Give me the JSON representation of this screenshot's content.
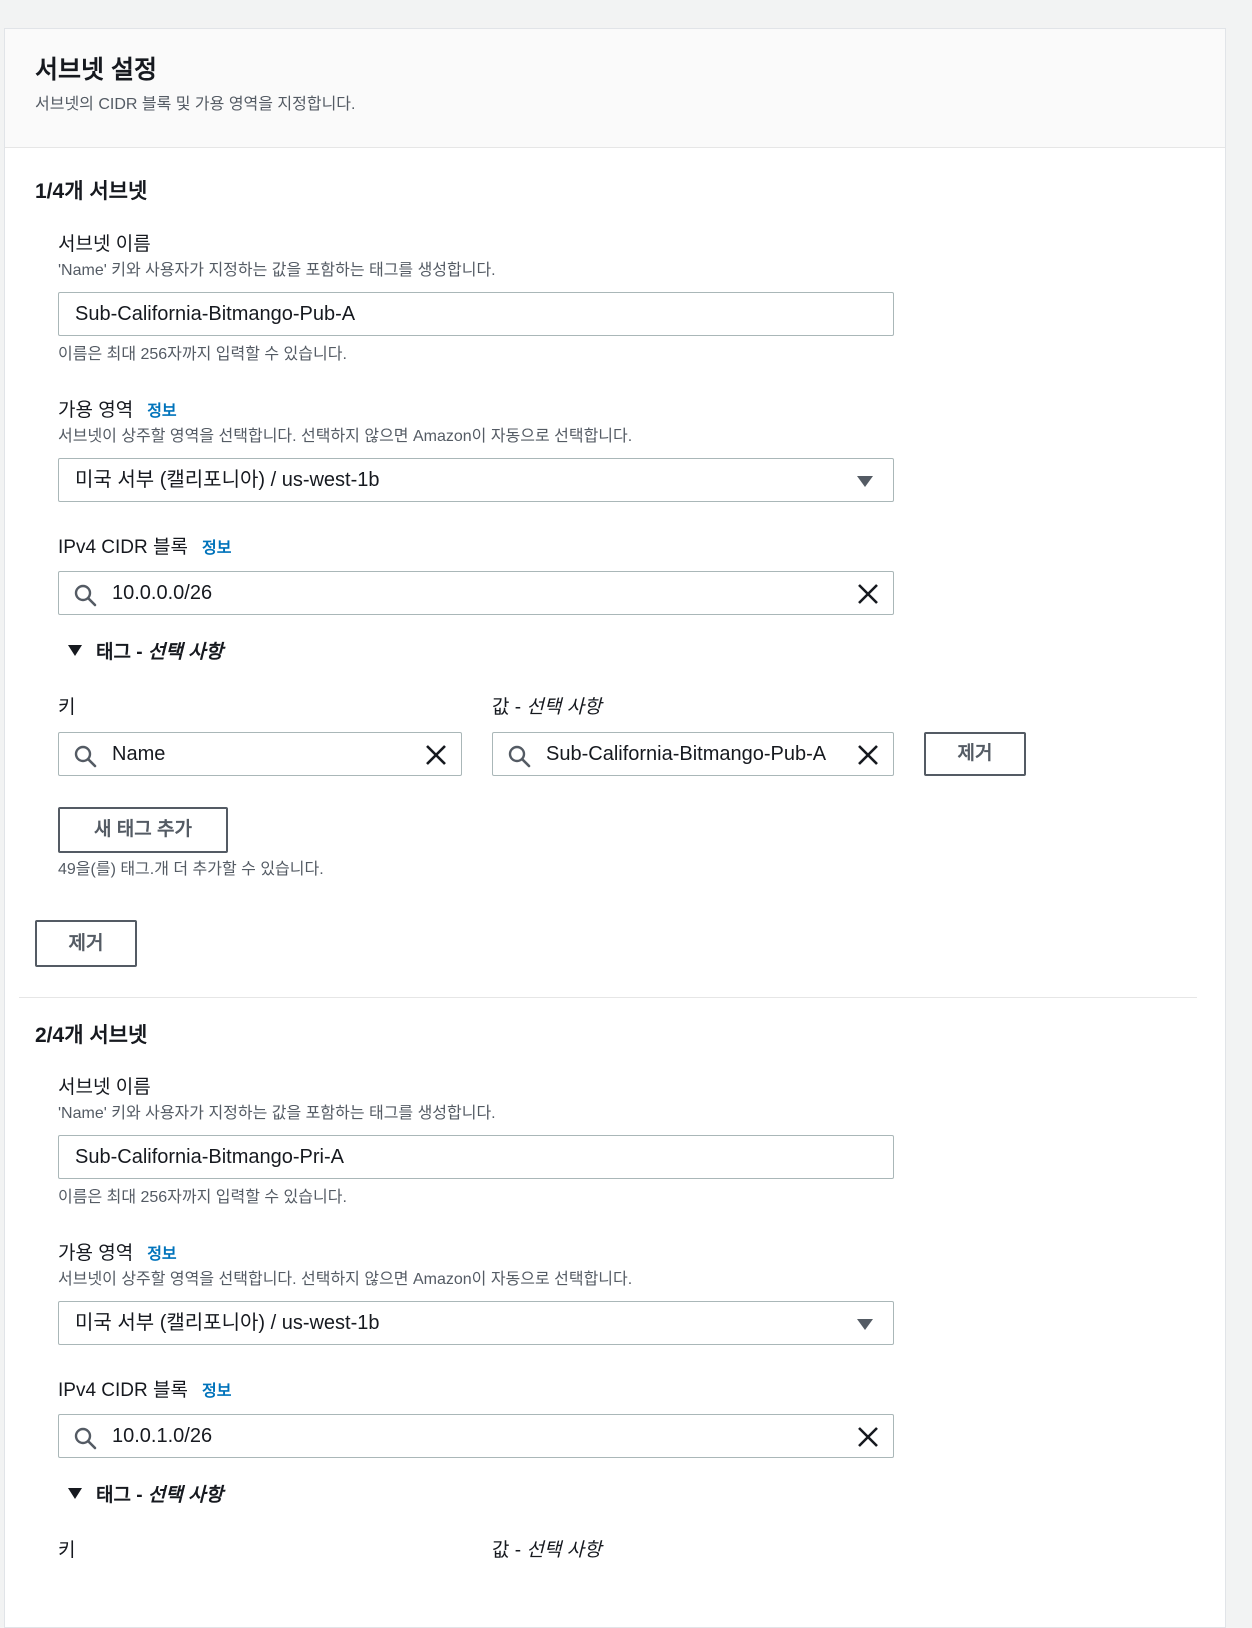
{
  "header": {
    "title": "서브넷 설정",
    "description": "서브넷의 CIDR 블록 및 가용 영역을 지정합니다."
  },
  "subnets": [
    {
      "title": "1/4개 서브넷",
      "name_label": "서브넷 이름",
      "name_desc": "'Name' 키와 사용자가 지정하는 값을 포함하는 태그를 생성합니다.",
      "name_value": "Sub-California-Bitmango-Pub-A",
      "name_hint": "이름은 최대 256자까지 입력할 수 있습니다.",
      "az_label": "가용 영역",
      "az_info": "정보",
      "az_desc": "서브넷이 상주할 영역을 선택합니다. 선택하지 않으면 Amazon이 자동으로 선택합니다.",
      "az_value": "미국 서부 (캘리포니아) / us-west-1b",
      "cidr_label": "IPv4 CIDR 블록",
      "cidr_info": "정보",
      "cidr_value": "10.0.0.0/26",
      "tags_toggle": "태그 - ",
      "tags_toggle_opt": "선택 사항",
      "key_label": "키",
      "value_label": "값 - ",
      "value_label_opt": "선택 사항",
      "tag_key": "Name",
      "tag_value": "Sub-California-Bitmango-Pub-A",
      "remove_tag_button": "제거",
      "add_tag_button": "새 태그 추가",
      "tag_limit_hint": "49을(를) 태그.개 더 추가할 수 있습니다.",
      "remove_subnet_button": "제거"
    },
    {
      "title": "2/4개 서브넷",
      "name_label": "서브넷 이름",
      "name_desc": "'Name' 키와 사용자가 지정하는 값을 포함하는 태그를 생성합니다.",
      "name_value": "Sub-California-Bitmango-Pri-A",
      "name_hint": "이름은 최대 256자까지 입력할 수 있습니다.",
      "az_label": "가용 영역",
      "az_info": "정보",
      "az_desc": "서브넷이 상주할 영역을 선택합니다. 선택하지 않으면 Amazon이 자동으로 선택합니다.",
      "az_value": "미국 서부 (캘리포니아) / us-west-1b",
      "cidr_label": "IPv4 CIDR 블록",
      "cidr_info": "정보",
      "cidr_value": "10.0.1.0/26",
      "tags_toggle": "태그 - ",
      "tags_toggle_opt": "선택 사항",
      "key_label": "키",
      "value_label": "값 - ",
      "value_label_opt": "선택 사항"
    }
  ],
  "colors": {
    "link": "#0073bb",
    "border": "#aab7b8",
    "text": "#16191f",
    "muted": "#545b64"
  }
}
